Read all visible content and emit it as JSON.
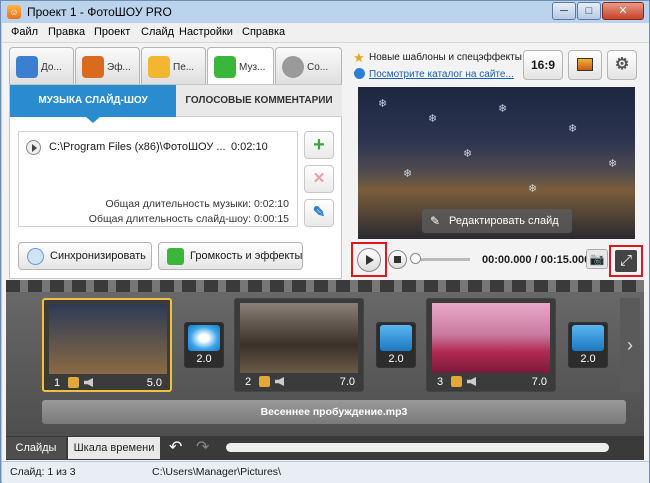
{
  "window": {
    "title": "Проект 1 - ФотоШОУ PRO",
    "icon_text": "☺",
    "minimize": "─",
    "maximize": "□",
    "close": "✕"
  },
  "menu": [
    "Файл",
    "Правка",
    "Проект",
    "Слайд",
    "Настройки",
    "Справка"
  ],
  "tabs": [
    {
      "label": "До...",
      "icon": "photo-add-icon",
      "color": "#3a7fd0"
    },
    {
      "label": "Эф...",
      "icon": "palette-icon",
      "color": "#d96a1e"
    },
    {
      "label": "Пе...",
      "icon": "star-icon",
      "color": "#f2b630"
    },
    {
      "label": "Муз...",
      "icon": "music-note-icon",
      "color": "#3ab63a"
    },
    {
      "label": "Со...",
      "icon": "reel-icon",
      "color": "#9a9a9a"
    }
  ],
  "music_panel": {
    "tab_active": "МУЗЫКА СЛАЙД-ШОУ",
    "tab_inactive": "ГОЛОСОВЫЕ КОММЕНТАРИИ",
    "track": {
      "path": "C:\\Program Files (x86)\\ФотоШОУ ...",
      "duration": "0:02:10"
    },
    "total_music": "Общая длительность музыки: 0:02:10",
    "total_slideshow": "Общая длительность слайд-шоу: 0:00:15",
    "add": "+",
    "remove": "✕",
    "clean": "✎",
    "sync_button": "Синхронизировать",
    "volume_button": "Громкость и эффекты"
  },
  "right": {
    "promo_line1": "Новые шаблоны и спецэффекты",
    "promo_line2": "Посмотрите каталог на сайте...",
    "aspect": "16:9",
    "background_icon": "picture-icon",
    "settings_icon": "gear-icon",
    "edit_slide": "Редактировать слайд",
    "timecode": "00:00.000 / 00:15.000",
    "camera": "📷"
  },
  "slides": [
    {
      "num": "1",
      "duration": "5.0",
      "selected": true,
      "thumb": [
        "#2d3a55",
        "#8a6a45"
      ]
    },
    {
      "num": "2",
      "duration": "7.0",
      "selected": false,
      "thumb": [
        "#6f6060",
        "#2a2420"
      ]
    },
    {
      "num": "3",
      "duration": "7.0",
      "selected": false,
      "thumb": [
        "#e9a9c8",
        "#b02a52"
      ]
    }
  ],
  "transitions": [
    {
      "duration": "2.0"
    },
    {
      "duration": "2.0"
    },
    {
      "duration": "2.0"
    }
  ],
  "audio_track": "Весеннее пробуждение.mp3",
  "bottom": {
    "tab_slides": "Слайды",
    "tab_timeline": "Шкала времени",
    "undo": "↶",
    "redo": "↷",
    "next": "›"
  },
  "status": {
    "slide": "Слайд: 1 из 3",
    "path": "C:\\Users\\Manager\\Pictures\\"
  }
}
